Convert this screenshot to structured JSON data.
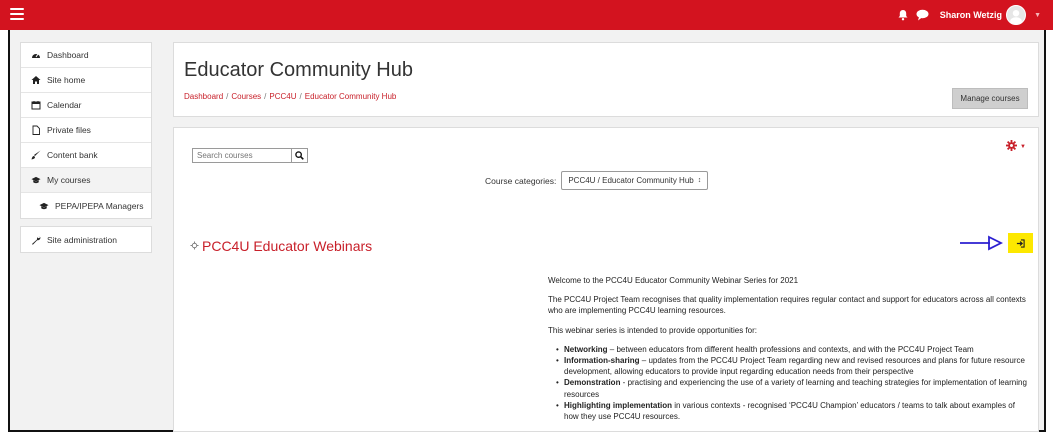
{
  "header": {
    "user_name": "Sharon Wetzig"
  },
  "sidebar": {
    "group1": [
      {
        "label": "Dashboard",
        "icon": "dashboard-icon"
      },
      {
        "label": "Site home",
        "icon": "home-icon"
      },
      {
        "label": "Calendar",
        "icon": "calendar-icon"
      },
      {
        "label": "Private files",
        "icon": "file-icon"
      },
      {
        "label": "Content bank",
        "icon": "paintbrush-icon"
      },
      {
        "label": "My courses",
        "icon": "graduation-cap-icon"
      },
      {
        "label": "PEPA/IPEPA Managers",
        "icon": "graduation-cap-icon"
      }
    ],
    "group2": [
      {
        "label": "Site administration",
        "icon": "wrench-icon"
      }
    ]
  },
  "page": {
    "title": "Educator Community Hub",
    "breadcrumb": [
      "Dashboard",
      "Courses",
      "PCC4U",
      "Educator Community Hub"
    ],
    "breadcrumb_sep": "/",
    "manage_courses_label": "Manage courses"
  },
  "main": {
    "search_placeholder": "Search courses",
    "categories_label": "Course categories:",
    "categories_value": "PCC4U / Educator Community Hub",
    "categories_arrows": "↕",
    "course_title": "PCC4U Educator Webinars",
    "summary": {
      "p1": "Welcome to the PCC4U Educator Community Webinar Series for 2021",
      "p2": "The PCC4U Project Team recognises that quality implementation requires regular contact and support for educators across all contexts who are implementing PCC4U learning resources.",
      "p3": "This webinar series is intended to provide opportunities for:",
      "bullets": [
        {
          "bold": "Networking",
          "text": " – between educators from different health professions and contexts, and with the PCC4U Project Team"
        },
        {
          "bold": "Information-sharing",
          "text": " – updates from the PCC4U Project Team regarding new and revised resources and plans for future resource development, allowing educators to provide input regarding education needs from their perspective"
        },
        {
          "bold": "Demonstration",
          "text": " - practising and experiencing the use of a variety of learning and teaching strategies for implementation of learning resources"
        },
        {
          "bold": "Highlighting implementation",
          "text": " in various contexts - recognised ‘PCC4U Champion’ educators / teams to talk about examples of how they use PCC4U resources."
        }
      ]
    }
  },
  "colors": {
    "brand_red": "#d3131f",
    "link_red": "#c8202a",
    "enrol_yellow": "#fde800",
    "annotation_purple": "#2b1fd1"
  }
}
